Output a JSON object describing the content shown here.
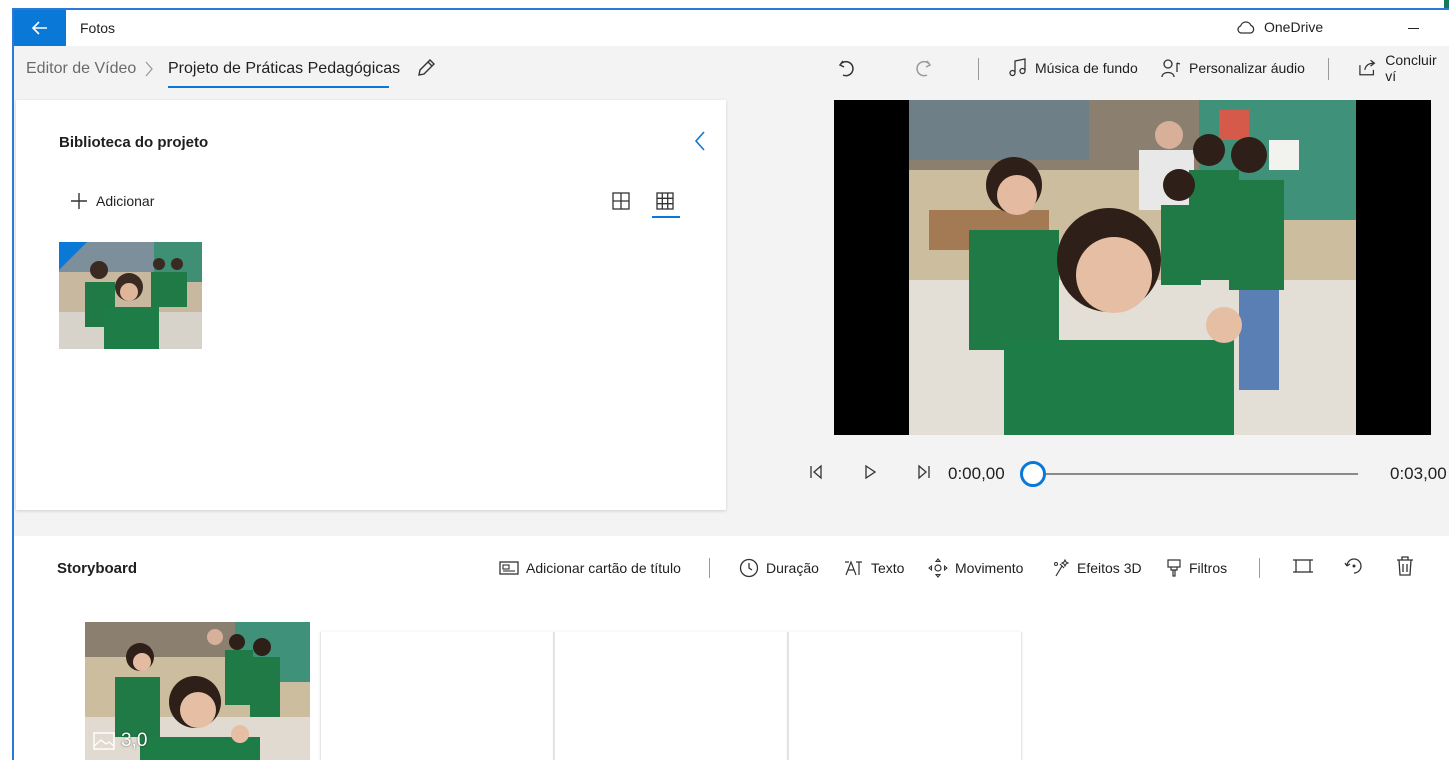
{
  "titlebar": {
    "app_title": "Fotos",
    "onedrive_label": "OneDrive",
    "accent_color": "#0a78d7"
  },
  "toolbar": {
    "breadcrumb_root": "Editor de Vídeo",
    "project_name": "Projeto de Práticas Pedagógicas",
    "background_music_label": "Música de fundo",
    "custom_audio_label": "Personalizar áudio",
    "finish_video_label": "Concluir ví"
  },
  "library": {
    "title": "Biblioteca do projeto",
    "add_label": "Adicionar"
  },
  "playback": {
    "current_time": "0:00,00",
    "total_time": "0:03,00",
    "progress": 0
  },
  "storyboard": {
    "title": "Storyboard",
    "tools": {
      "add_title_card": "Adicionar cartão de título",
      "duration": "Duração",
      "text": "Texto",
      "motion": "Movimento",
      "effects_3d": "Efeitos 3D",
      "filters": "Filtros"
    },
    "clips": [
      {
        "duration": "3,0"
      }
    ]
  }
}
